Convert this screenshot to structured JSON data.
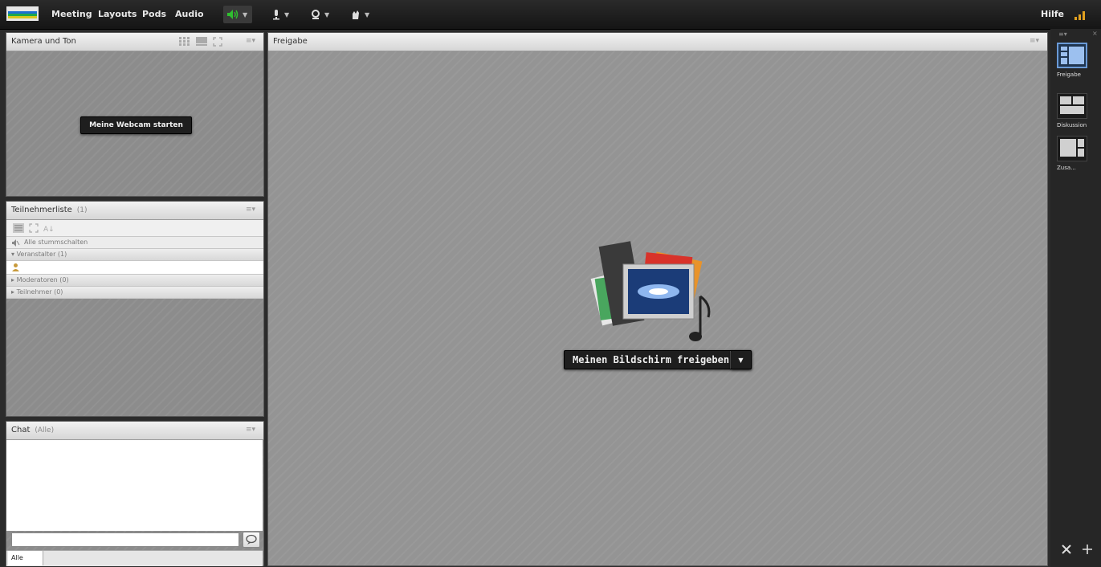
{
  "topbar": {
    "menu": [
      "Meeting",
      "Layouts",
      "Pods",
      "Audio"
    ],
    "help_label": "Hilfe",
    "icons": [
      "speaker-icon",
      "microphone-icon",
      "webcam-icon",
      "raise-hand-icon"
    ]
  },
  "camera_pod": {
    "title": "Kamera und Ton",
    "start_webcam_label": "Meine Webcam starten"
  },
  "attendee_pod": {
    "title": "Teilnehmerliste",
    "count": "(1)",
    "mute_all_label": "Alle stummschalten",
    "groups": [
      {
        "label": "Veranstalter (1)",
        "expanded": true
      },
      {
        "label": "Moderatoren (0)",
        "expanded": false
      },
      {
        "label": "Teilnehmer (0)",
        "expanded": false
      }
    ]
  },
  "chat_pod": {
    "title": "Chat",
    "scope": "(Alle)",
    "input_placeholder": "",
    "tab_label": "Alle"
  },
  "share_pod": {
    "title": "Freigabe",
    "share_button_label": "Meinen Bildschirm freigeben"
  },
  "layouts": {
    "items": [
      "Freigabe",
      "Diskussion",
      "Zusa..."
    ],
    "selected_index": 0
  },
  "colors": {
    "topbar": "#1c1c1c",
    "pod_body": "#8c8c8c",
    "pod_header": "#e4e4e4",
    "layout_selected": "#6a9ad6",
    "speaker_active": "#2fbf2f"
  }
}
